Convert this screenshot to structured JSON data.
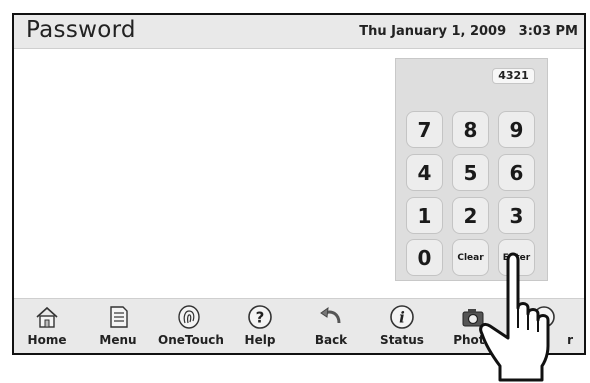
{
  "header": {
    "title": "Password",
    "date": "Thu January 1, 2009",
    "time": "3:03 PM"
  },
  "keypad": {
    "display_value": "4321",
    "keys": [
      "7",
      "8",
      "9",
      "4",
      "5",
      "6",
      "1",
      "2",
      "3",
      "0",
      "Clear",
      "Enter"
    ]
  },
  "nav": {
    "items": [
      {
        "label": "Home",
        "icon": "house-icon"
      },
      {
        "label": "Menu",
        "icon": "notepad-icon"
      },
      {
        "label": "OneTouch",
        "icon": "fingerprint-icon"
      },
      {
        "label": "Help",
        "icon": "question-icon"
      },
      {
        "label": "Back",
        "icon": "back-arrow-icon"
      },
      {
        "label": "Status",
        "icon": "info-icon"
      },
      {
        "label": "Photo",
        "icon": "camera-icon"
      },
      {
        "label": "r",
        "icon": "partial-icon"
      }
    ]
  }
}
